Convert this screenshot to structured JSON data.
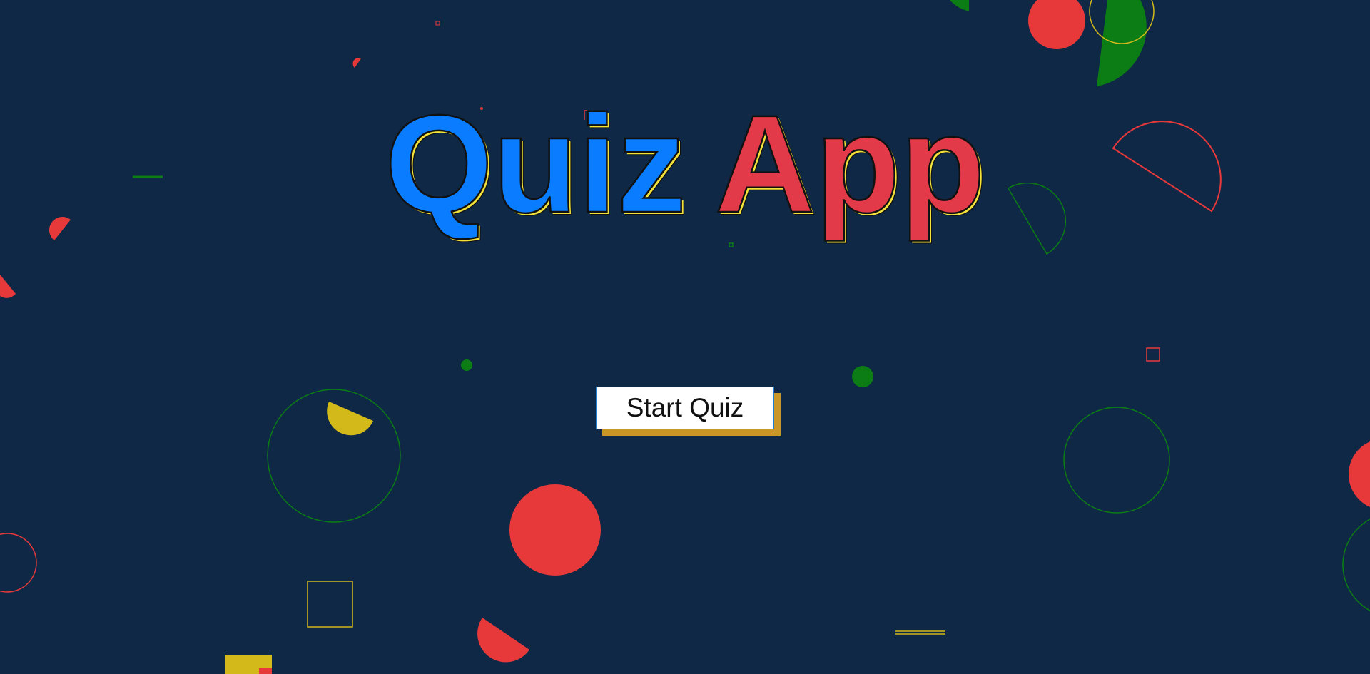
{
  "app": {
    "title_word_1": "Quiz",
    "title_word_2": "App"
  },
  "start_button": {
    "label": "Start Quiz"
  },
  "colors": {
    "background": "#0f2846",
    "title_quiz": "#0a7cff",
    "title_app": "#e23a48",
    "title_outline_accent": "#f2e23a",
    "button_background": "#ffffff",
    "button_shadow": "#c99628",
    "shape_red": "#e8393a",
    "shape_green": "#0b7d14",
    "shape_yellow": "#d4b91a"
  },
  "decorations": {
    "shape_palette": [
      "red",
      "green",
      "yellow"
    ]
  }
}
